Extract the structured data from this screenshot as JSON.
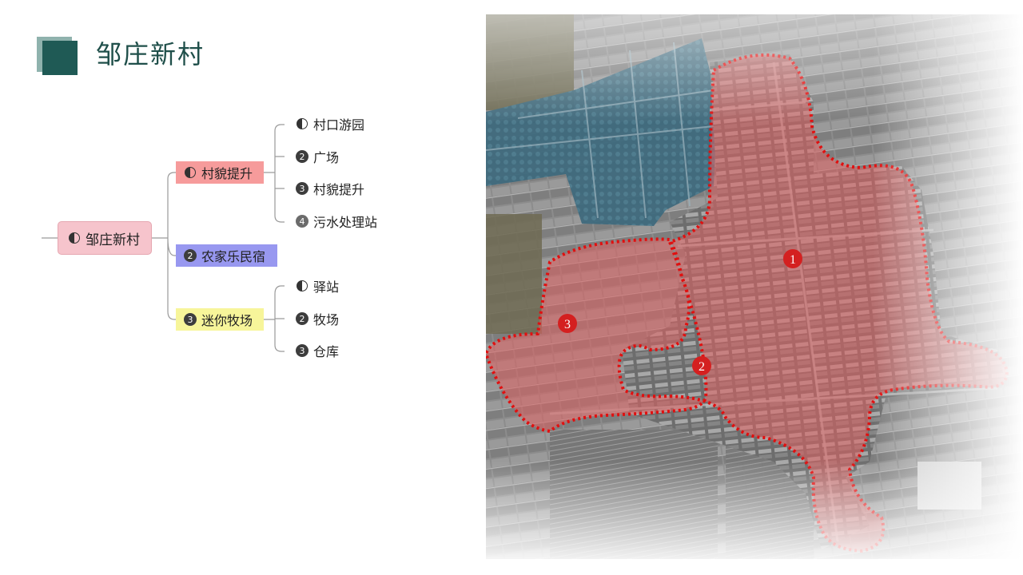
{
  "title": "邹庄新村",
  "mindmap": {
    "root": {
      "badge": "half",
      "label": "邹庄新村"
    },
    "branches": [
      {
        "badge": "half",
        "label": "村貌提升",
        "children": [
          {
            "badge": "half",
            "label": "村口游园"
          },
          {
            "badge": "2",
            "label": "广场"
          },
          {
            "badge": "3",
            "label": "村貌提升"
          },
          {
            "badge": "4",
            "label": "污水处理站"
          }
        ]
      },
      {
        "badge": "2",
        "label": "农家乐民宿",
        "children": []
      },
      {
        "badge": "3",
        "label": "迷你牧场",
        "children": [
          {
            "badge": "half",
            "label": "驿站"
          },
          {
            "badge": "2",
            "label": "牧场"
          },
          {
            "badge": "3",
            "label": "仓库"
          }
        ]
      }
    ]
  },
  "map": {
    "markers": [
      "1",
      "2",
      "3"
    ],
    "colors": {
      "zone_fill": "#e06060",
      "zone_border": "#e01010",
      "marker": "#d42020",
      "blue_zone": "#3a6b82"
    }
  }
}
